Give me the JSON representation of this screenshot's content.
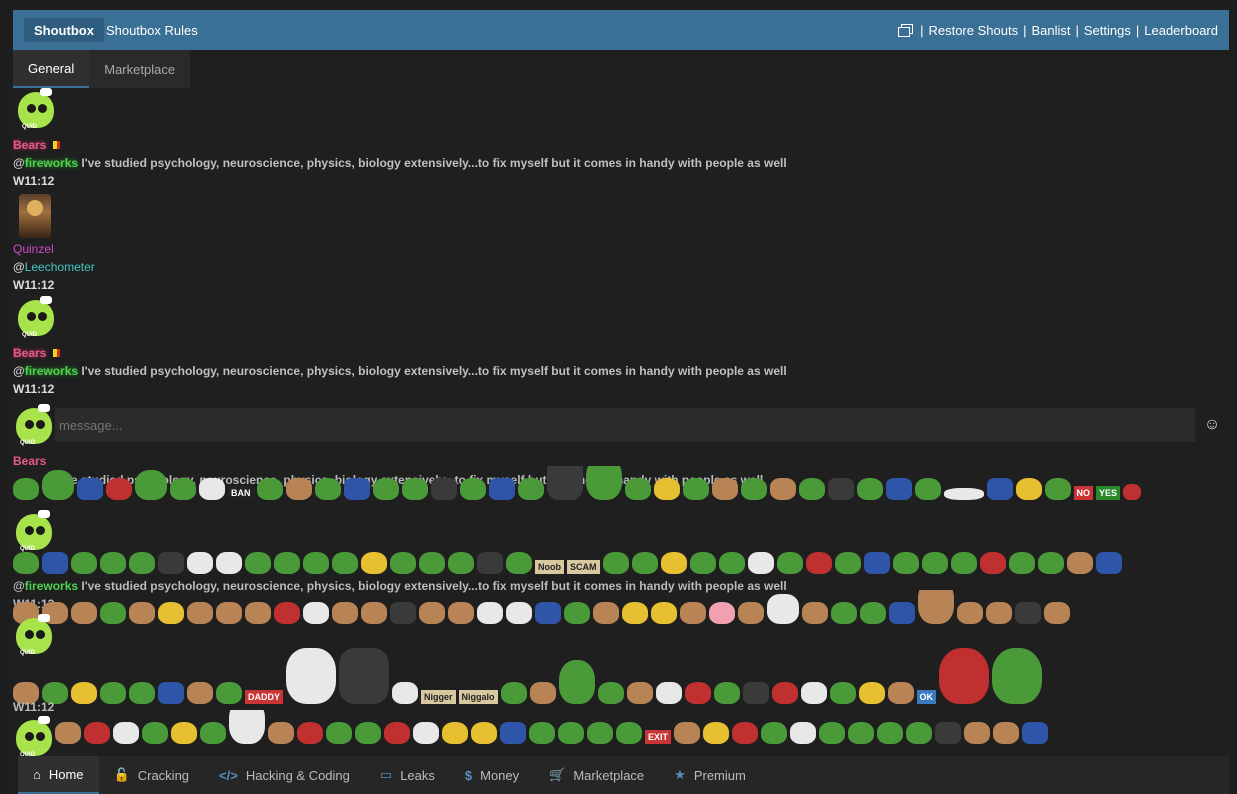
{
  "header": {
    "brand": "Shoutbox",
    "rules": "Shoutbox Rules",
    "restore": "Restore Shouts",
    "banlist": "Banlist",
    "settings": "Settings",
    "leaderboard": "Leaderboard",
    "separator": "|"
  },
  "tabs": [
    {
      "label": "General",
      "active": true
    },
    {
      "label": "Marketplace",
      "active": false
    }
  ],
  "messages": [
    {
      "user": "Bears",
      "mention": "@",
      "mention_user": "fireworks",
      "text": " I've studied psychology, neuroscience, physics, biology extensively...to fix myself but it comes in handy with people as well",
      "time": "W11:12"
    },
    {
      "user": "Quinzel",
      "mention": "@",
      "mention_user": "Leechometer",
      "text": "",
      "time": "W11:12"
    },
    {
      "user": "Bears",
      "mention": "@",
      "mention_user": "fireworks",
      "text": " I've studied psychology, neuroscience, physics, biology extensively...to fix myself but it comes in handy with people as well",
      "time": "W11:12"
    }
  ],
  "input": {
    "placeholder": "message..."
  },
  "ghost": {
    "user": "Bears",
    "line1": "I've studied psychology, neuroscience, physics, biology extensively...to fix myself but it comes in handy with people as well",
    "line2_who": "fireworks",
    "time1": "W11:12",
    "time2": "W11:12",
    "tail": "well"
  },
  "emoji_tags": {
    "ban": "BAN",
    "noob": "Noob",
    "scam": "SCAM",
    "daddy": "DADDY",
    "nigger": "Nigger",
    "niggalo": "Niggalo",
    "exit": "EXIT",
    "no": "NO",
    "yes": "YES",
    "ok": "OK"
  },
  "bottom_nav": [
    {
      "label": "Home",
      "icon": "home-icon",
      "glyph": "⌂",
      "active": true
    },
    {
      "label": "Cracking",
      "icon": "lock-icon",
      "glyph": "🔓",
      "active": false
    },
    {
      "label": "Hacking & Coding",
      "icon": "code-icon",
      "glyph": "</>",
      "active": false
    },
    {
      "label": "Leaks",
      "icon": "laptop-icon",
      "glyph": "▭",
      "active": false
    },
    {
      "label": "Money",
      "icon": "dollar-icon",
      "glyph": "$",
      "active": false
    },
    {
      "label": "Marketplace",
      "icon": "cart-icon",
      "glyph": "🛒",
      "active": false
    },
    {
      "label": "Premium",
      "icon": "star-icon",
      "glyph": "★",
      "active": false
    }
  ],
  "colors": {
    "header": "#3a6f96",
    "bears": "#e85a8a",
    "quinzel": "#d04ac8",
    "fireworks": "#4fd34f",
    "leechometer": "#40c8c0"
  }
}
